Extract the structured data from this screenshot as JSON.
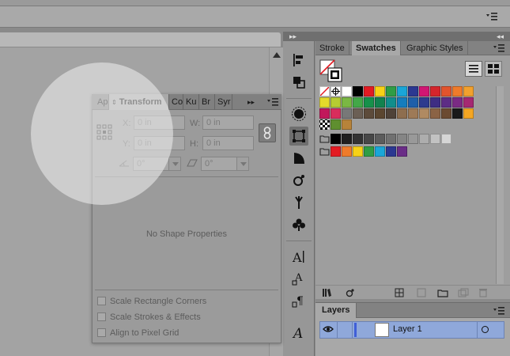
{
  "control_bar": {
    "menu_icon": "panel-menu-icon"
  },
  "dock": {
    "collapse_left": "▸▸",
    "collapse_right": "◂◂"
  },
  "swatches_panel": {
    "tabs": [
      {
        "label": "Stroke",
        "active": false
      },
      {
        "label": "Swatches",
        "active": true
      },
      {
        "label": "Graphic Styles",
        "active": false
      }
    ],
    "view_modes": [
      "list-view-icon",
      "thumbnail-view-icon"
    ],
    "rows": [
      [
        "#ffffff",
        "#ffffff",
        "#ffffff",
        "#000000",
        "#e31b23",
        "#f7d116",
        "#2f9d45",
        "#1aa6d8",
        "#2b3891",
        "#d01673",
        "#d4252c",
        "#e2542d",
        "#ef7b2b",
        "#f2a12e"
      ],
      [
        "#e4da2b",
        "#b6cc32",
        "#7ab843",
        "#43a848",
        "#16914a",
        "#12824e",
        "#118e8c",
        "#157dbd",
        "#1f5fa9",
        "#2d3b8e",
        "#3e2d83",
        "#5d2d85",
        "#7b2b84",
        "#a52972"
      ],
      [
        "#c2185b",
        "#d92d5c",
        "#787878",
        "#6b5f55",
        "#5d4b3b",
        "#5b4630",
        "#4f4238",
        "#8e6e4f",
        "#9e7a57",
        "#b08a62",
        "#8b6345",
        "#6b4a31",
        "#1a1a1a",
        "#f5a623"
      ],
      [
        "#ffffff",
        "#5f8f2f",
        "#b7833a"
      ],
      [
        "#4d4d4d",
        "#000000",
        "#1f1f1f",
        "#333333",
        "#474747",
        "#5c5c5c",
        "#707070",
        "#858585",
        "#999999",
        "#adadad",
        "#c2c2c2",
        "#d6d6d6"
      ],
      [
        "#4d4d4d",
        "#e31b23",
        "#ef7b2b",
        "#f7d116",
        "#2f9d45",
        "#1aa6d8",
        "#2b3891",
        "#6a2d87"
      ]
    ]
  },
  "layers_panel": {
    "title": "Layers",
    "layers": [
      {
        "name": "Layer 1",
        "visible": true,
        "color": "#3f5fd8"
      }
    ]
  },
  "transform_panel": {
    "tabs": [
      {
        "label": "Ap",
        "active": false
      },
      {
        "label": "Transform",
        "active": true
      },
      {
        "label": "Co",
        "active": false
      },
      {
        "label": "Ku",
        "active": false
      },
      {
        "label": "Br",
        "active": false
      },
      {
        "label": "Syr",
        "active": false
      }
    ],
    "overflow": "▸▸",
    "x_label": "X:",
    "x_value": "0 in",
    "y_label": "Y:",
    "y_value": "0 in",
    "w_label": "W:",
    "w_value": "0 in",
    "h_label": "H:",
    "h_value": "0 in",
    "rotate_value": "0°",
    "shear_value": "0°",
    "empty_message": "No Shape Properties",
    "options": [
      {
        "label": "Scale Rectangle Corners",
        "checked": false
      },
      {
        "label": "Scale Strokes & Effects",
        "checked": false
      },
      {
        "label": "Align to Pixel Grid",
        "checked": false
      }
    ]
  },
  "accent": "#8fa8da"
}
